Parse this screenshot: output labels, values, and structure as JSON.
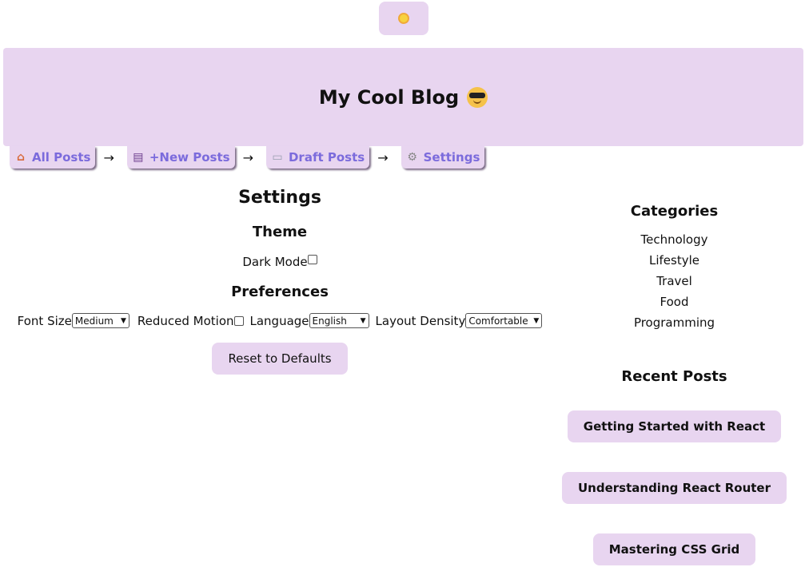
{
  "theme_toggle": {
    "icon": "sun-icon"
  },
  "header": {
    "title": "My Cool Blog",
    "emoji": "cool-face-icon"
  },
  "nav": {
    "items": [
      {
        "label": "All Posts",
        "icon": "home-icon"
      },
      {
        "label": "+New Posts",
        "icon": "notebook-icon"
      },
      {
        "label": "Draft Posts",
        "icon": "draft-icon"
      },
      {
        "label": "Settings",
        "icon": "gear-icon"
      }
    ],
    "separator": "→"
  },
  "settings": {
    "title": "Settings",
    "theme_heading": "Theme",
    "dark_mode_label": "Dark Mode",
    "preferences_heading": "Preferences",
    "font_size_label": "Font Size",
    "font_size_value": "Medium",
    "reduced_motion_label": "Reduced Motion",
    "language_label": "Language",
    "language_value": "English",
    "layout_density_label": "Layout Density",
    "layout_density_value": "Comfortable",
    "reset_label": "Reset to Defaults"
  },
  "sidebar": {
    "categories_heading": "Categories",
    "categories": [
      "Technology",
      "Lifestyle",
      "Travel",
      "Food",
      "Programming"
    ],
    "recent_heading": "Recent Posts",
    "recent_posts": [
      "Getting Started with React",
      "Understanding React Router",
      "Mastering CSS Grid"
    ]
  },
  "colors": {
    "accent_bg": "#e8d5f0",
    "nav_text": "#7b6bdc"
  }
}
